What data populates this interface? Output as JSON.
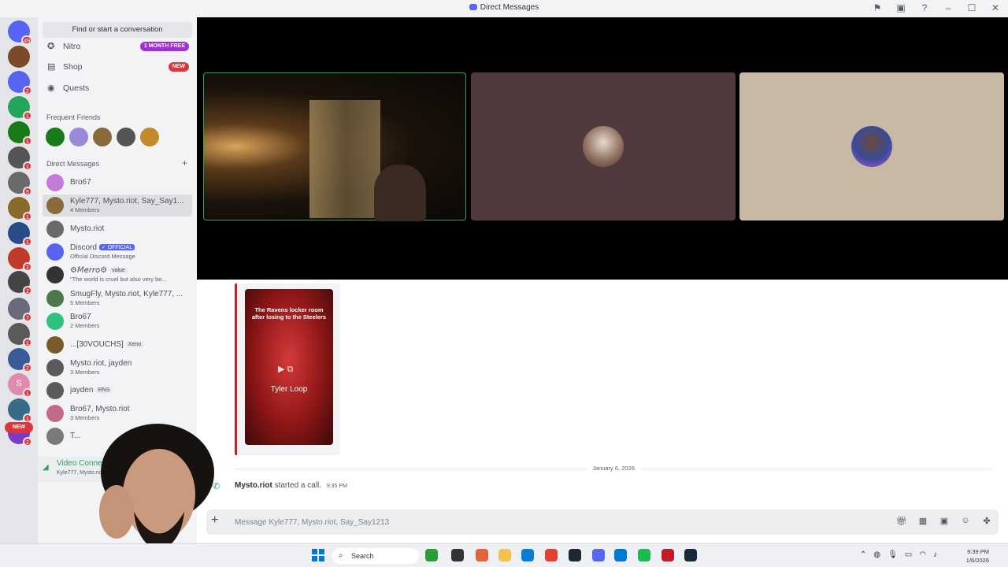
{
  "window": {
    "title": "Direct Messages"
  },
  "titlebar_icons": [
    "inbox-flag-icon",
    "window-icon",
    "help-icon",
    "minimize-icon",
    "maximize-icon",
    "close-icon"
  ],
  "servers": [
    {
      "badge": "49",
      "color": "#5865f2"
    },
    {
      "badge": "",
      "color": "#7a4a2a"
    },
    {
      "badge": "2",
      "color": "#5865f2"
    },
    {
      "badge": "1",
      "color": "#23a55a"
    },
    {
      "badge": "1",
      "color": "#1a7a1a"
    },
    {
      "badge": "1",
      "color": "#555"
    },
    {
      "badge": "5",
      "color": "#6a6a6a"
    },
    {
      "badge": "1",
      "color": "#8a6a2a"
    },
    {
      "badge": "1",
      "color": "#2a4a8a"
    },
    {
      "badge": "2",
      "color": "#c23a2a"
    },
    {
      "badge": "2",
      "color": "#444"
    },
    {
      "badge": "7",
      "color": "#6a6a7a"
    },
    {
      "badge": "1",
      "color": "#5a5a5a"
    },
    {
      "badge": "2",
      "color": "#3a5a9a"
    },
    {
      "badge": "1",
      "color": "#e08ab0",
      "letter": "S"
    },
    {
      "badge": "1",
      "color": "#3a6a8a"
    },
    {
      "badge": "2",
      "color": "#7a3ac2"
    }
  ],
  "new_pill": "NEW",
  "sidebar": {
    "search_placeholder": "Find or start a conversation",
    "nav": [
      {
        "label": "Nitro",
        "icon": "nitro-icon",
        "pill": "1 MONTH FREE",
        "pill_color": "#a12fd6"
      },
      {
        "label": "Shop",
        "icon": "shop-icon",
        "pill": "NEW",
        "pill_color": "#da373c"
      },
      {
        "label": "Quests",
        "icon": "quests-icon",
        "pill": "",
        "pill_color": ""
      }
    ],
    "frequent_friends_label": "Frequent Friends",
    "direct_messages_label": "Direct Messages",
    "dms": [
      {
        "name": "Bro67",
        "sub": "",
        "tag": "",
        "color": "#c47ad8"
      },
      {
        "name": "Kyle777, Mysto.riot, Say_Say1...",
        "sub": "4 Members",
        "tag": "",
        "color": "#8a6a3a"
      },
      {
        "name": "Mysto.riot",
        "sub": "",
        "tag": "",
        "color": "#6a6a6a"
      },
      {
        "name": "Discord",
        "sub": "Official Discord Message",
        "tag": "✓ OFFICIAL",
        "color": "#5865f2"
      },
      {
        "name": "⚙𝘔𝘦𝘳𝘳𝘰⚙",
        "sub": "\"The world is cruel but also very be...",
        "tag": "value",
        "color": "#333"
      },
      {
        "name": "SmugFly, Mysto.riot, Kyle777, ...",
        "sub": "5 Members",
        "tag": "",
        "color": "#4a7a4a"
      },
      {
        "name": "Bro67",
        "sub": "2 Members",
        "tag": "",
        "color": "#2ec27e"
      },
      {
        "name": "...[30VOUCHS]",
        "sub": "",
        "tag": "Xeno",
        "color": "#7a5a2a"
      },
      {
        "name": "Mysto.riot, jayden",
        "sub": "3 Members",
        "tag": "",
        "color": "#5a5a5a"
      },
      {
        "name": "jayden",
        "sub": "",
        "tag": "RNS",
        "color": "#5a5a5a"
      },
      {
        "name": "Bro67, Mysto.riot",
        "sub": "3 Members",
        "tag": "",
        "color": "#c26a8a"
      },
      {
        "name": "T...",
        "sub": "",
        "tag": "",
        "color": "#7a7a7a"
      }
    ]
  },
  "voice": {
    "status": "Video Connected",
    "channel": "Kyle777, Mysto.riot, Sa..."
  },
  "call": {
    "tiles": [
      {
        "kind": "camera",
        "border": "#23a55a"
      },
      {
        "kind": "avatar",
        "bg": "#503a3e",
        "avatar_color": "#8a6a5a"
      },
      {
        "kind": "avatar",
        "bg": "#c7b9a3",
        "avatar_color": "#3a4a9a"
      }
    ]
  },
  "chat": {
    "embed": {
      "caption": "The Ravens locker room after losing to the Steelers",
      "overlay": "Tyler Loop"
    },
    "date_divider": "January 6, 2026",
    "system": {
      "user": "Mysto.riot",
      "text": "started a call.",
      "time": "9:35 PM"
    },
    "composer_placeholder": "Message Kyle777, Mysto.riot, Say_Say1213",
    "composer_tools": [
      "gift-icon",
      "gif-icon",
      "sticker-icon",
      "emoji-icon",
      "apps-icon"
    ]
  },
  "taskbar": {
    "search": "Search",
    "apps": [
      "#2a9d3a",
      "#333",
      "#e0653a",
      "#f2c14e",
      "#0a7ed6",
      "#e34133",
      "#1b2838",
      "#5865f2",
      "#0078d4",
      "#1db954",
      "#c21a2a",
      "#1b2838"
    ],
    "clock_time": "9:39 PM",
    "clock_date": "1/6/2026"
  }
}
